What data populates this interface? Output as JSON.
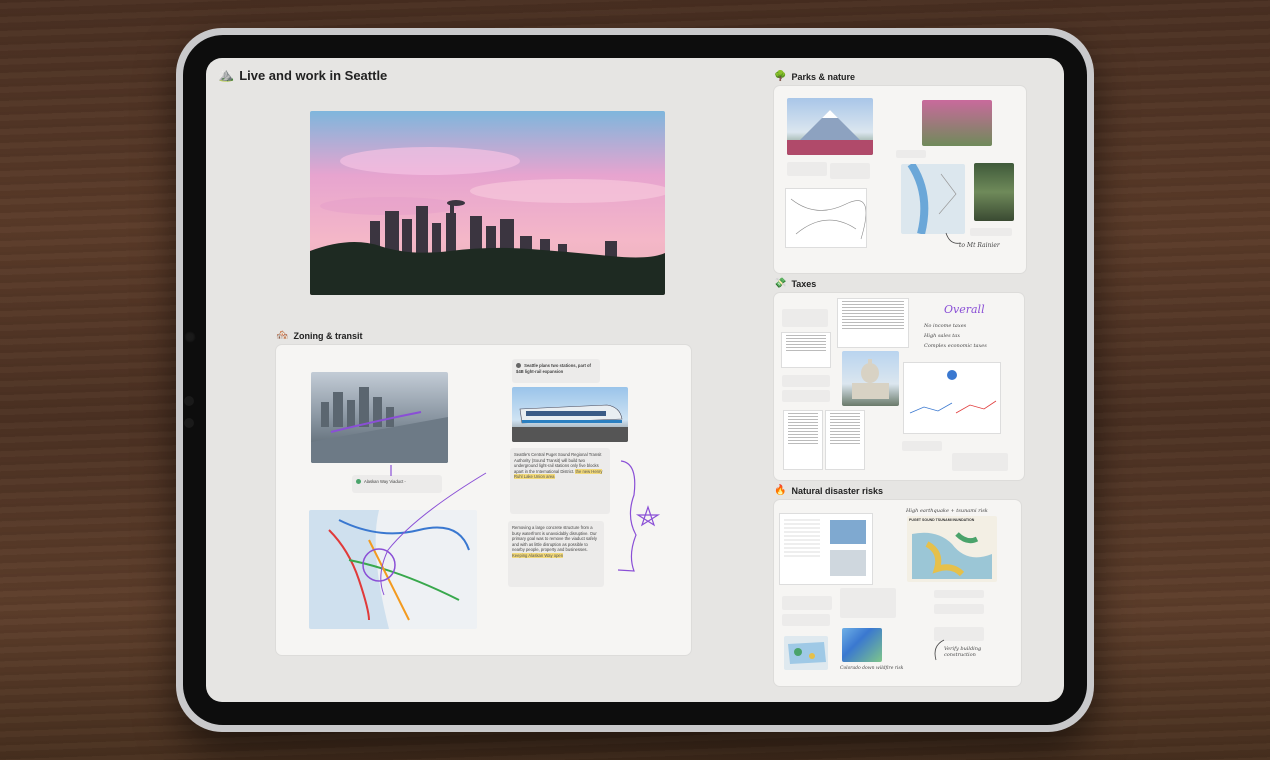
{
  "board": {
    "title": "Live and work in Seattle",
    "title_emoji": "⛰️"
  },
  "sections": {
    "zoning": {
      "title": "Zoning & transit",
      "emoji": "🏘️",
      "note_stations_title": "Seattle plans two stations, part of $4B light-rail expansion",
      "note_alaskan_title": "Alaskan Way Viaduct -",
      "note_sound_transit": "Seattle's Central Puget Sound Regional Transit Authority (Sound Transit) will build two underground light-rail stations only five blocks apart in the International District.",
      "note_sound_transit_hl": "the new Henry Ruhl Lake Union area",
      "note_removing": "Removing a large concrete structure from a busy waterfront is unavoidably disruptive. Our primary goal was to remove the viaduct safely and with as little disruption as possible to nearby people, property and businesses.",
      "note_removing_hl": "Keeping Alaskan Way open"
    },
    "parks": {
      "title": "Parks & nature",
      "emoji": "🌳",
      "handwriting": "to Mt Rainier"
    },
    "taxes": {
      "title": "Taxes",
      "emoji": "💸",
      "handwriting_title": "Overall",
      "handwriting_lines": [
        "No income taxes",
        "High sales tax",
        "Complex economic taxes"
      ]
    },
    "disaster": {
      "title": "Natural disaster risks",
      "emoji": "🔥",
      "handwriting_top": "High earthquake + tsunami risk",
      "handwriting_bottom_left": "Colorado down wildfire risk",
      "handwriting_bottom_right": "Verify building construction",
      "map_title": "PUGET SOUND TSUNAMI INUNDATION"
    }
  },
  "colors": {
    "accent_purple": "#8a4fd6",
    "highlight_yellow": "#f3da7a",
    "screen_bg": "#e6e5e3",
    "card_bg": "#f6f5f3"
  }
}
